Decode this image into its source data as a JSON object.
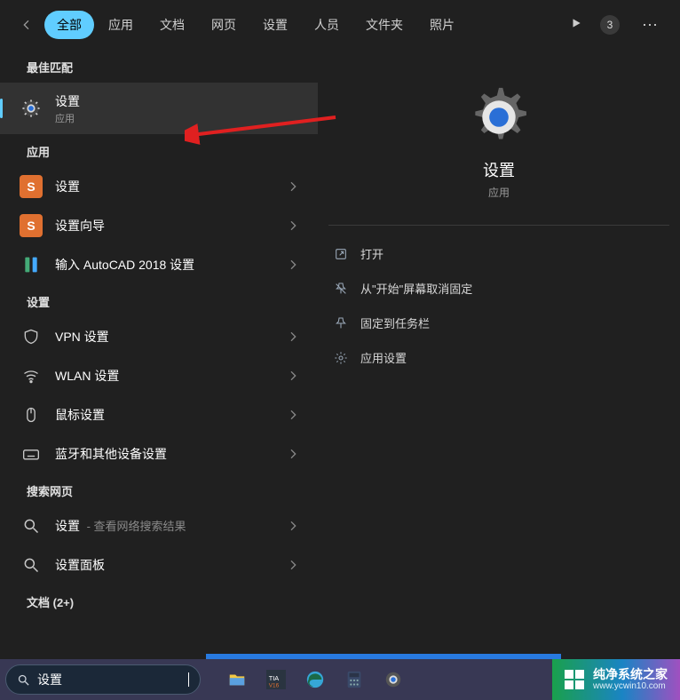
{
  "header": {
    "tabs": [
      "全部",
      "应用",
      "文档",
      "网页",
      "设置",
      "人员",
      "文件夹",
      "照片"
    ],
    "count": "3"
  },
  "left": {
    "best_match_label": "最佳匹配",
    "best_match": {
      "title": "设置",
      "sub": "应用"
    },
    "apps_label": "应用",
    "apps": [
      {
        "title": "设置"
      },
      {
        "title": "设置向导"
      },
      {
        "title": "输入 AutoCAD 2018 设置"
      }
    ],
    "settings_label": "设置",
    "settings": [
      {
        "title": "VPN 设置"
      },
      {
        "title": "WLAN 设置"
      },
      {
        "title": "鼠标设置"
      },
      {
        "title": "蓝牙和其他设备设置"
      }
    ],
    "web_label": "搜索网页",
    "web": [
      {
        "title": "设置",
        "sub": " - 查看网络搜索结果"
      },
      {
        "title": "设置面板"
      }
    ],
    "docs_label": "文档 (2+)"
  },
  "preview": {
    "title": "设置",
    "sub": "应用",
    "actions": [
      "打开",
      "从\"开始\"屏幕取消固定",
      "固定到任务栏",
      "应用设置"
    ]
  },
  "taskbar": {
    "search_value": "设置"
  },
  "brand": {
    "name": "纯净系统之家",
    "url": "www.ycwin10.com"
  }
}
